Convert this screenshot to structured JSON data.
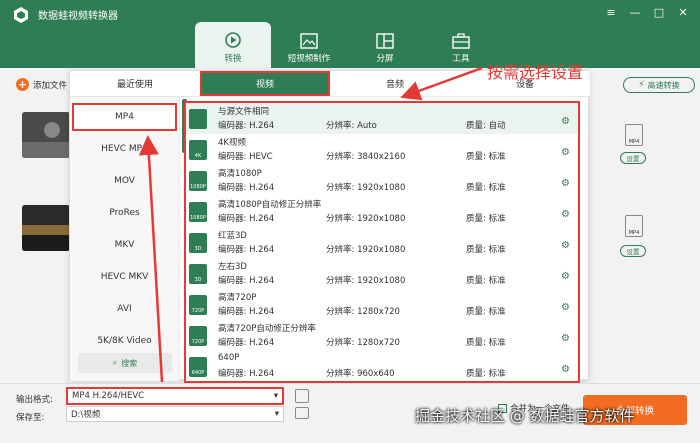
{
  "window": {
    "title": "数据蛙视频转换器",
    "controls": [
      "≡",
      "—",
      "□",
      "✕"
    ]
  },
  "topTabs": [
    {
      "label": "转换",
      "active": true
    },
    {
      "label": "短视频制作",
      "active": false
    },
    {
      "label": "分屏",
      "active": false
    },
    {
      "label": "工具",
      "active": false
    }
  ],
  "addFile": "添加文件",
  "fastConvert": "高速转换",
  "panelTabs": [
    {
      "label": "最近使用",
      "active": false
    },
    {
      "label": "视频",
      "active": true
    },
    {
      "label": "音频",
      "active": false
    },
    {
      "label": "设备",
      "active": false
    }
  ],
  "formats": [
    "MP4",
    "HEVC MP4",
    "MOV",
    "ProRes",
    "MKV",
    "HEVC MKV",
    "AVI",
    "5K/8K Video"
  ],
  "formatSearch": "搜索",
  "presets": [
    {
      "name": "与源文件相同",
      "enc": "编码器:  H.264",
      "res": "分辨率:   Auto",
      "q": "质量:   自动",
      "tag": ""
    },
    {
      "name": "4K视频",
      "enc": "编码器:  HEVC",
      "res": "分辨率:   3840x2160",
      "q": "质量:   标准",
      "tag": "4K"
    },
    {
      "name": "高清1080P",
      "enc": "编码器:  H.264",
      "res": "分辨率:   1920x1080",
      "q": "质量:   标准",
      "tag": "1080P"
    },
    {
      "name": "高清1080P自动修正分辨率",
      "enc": "编码器:  H.264",
      "res": "分辨率:   1920x1080",
      "q": "质量:   标准",
      "tag": "1080P"
    },
    {
      "name": "红蓝3D",
      "enc": "编码器:  H.264",
      "res": "分辨率:   1920x1080",
      "q": "质量:   标准",
      "tag": "3D"
    },
    {
      "name": "左右3D",
      "enc": "编码器:  H.264",
      "res": "分辨率:   1920x1080",
      "q": "质量:   标准",
      "tag": "3D"
    },
    {
      "name": "高清720P",
      "enc": "编码器:  H.264",
      "res": "分辨率:   1280x720",
      "q": "质量:   标准",
      "tag": "720P"
    },
    {
      "name": "高清720P自动修正分辨率",
      "enc": "编码器:  H.264",
      "res": "分辨率:   1280x720",
      "q": "质量:   标准",
      "tag": "720P"
    },
    {
      "name": "640P",
      "enc": "编码器:  H.264",
      "res": "分辨率:   960x640",
      "q": "质量:   标准",
      "tag": "640P"
    }
  ],
  "annotation": "按需选择设置",
  "fileChips": [
    {
      "format": "MP4",
      "setting": "设置"
    },
    {
      "format": "MP4",
      "setting": "设置"
    }
  ],
  "bottom": {
    "outputLabel": "输出格式:",
    "outputValue": "MP4 H.264/HEVC",
    "saveLabel": "保存至:",
    "savePath": "D:\\视频",
    "merge": "合并为一个文件",
    "convertAll": "全部转换"
  },
  "watermark": "掘金技术社区 @ 数据蛙官方软件"
}
